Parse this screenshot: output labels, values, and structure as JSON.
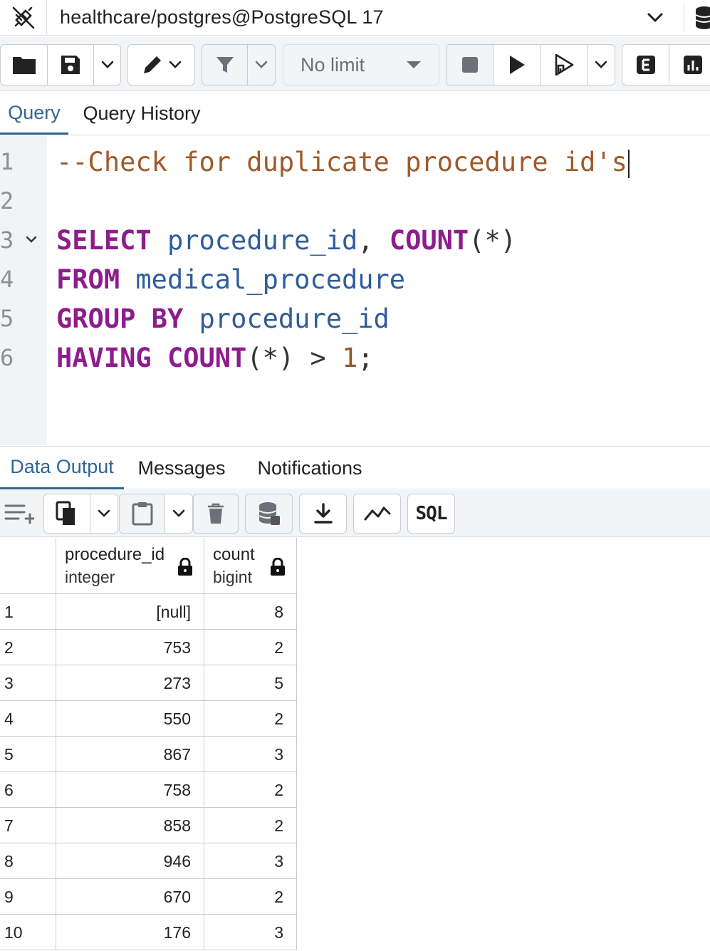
{
  "connection": {
    "label": "healthcare/postgres@PostgreSQL 17"
  },
  "toolbar": {
    "limit_label": "No limit"
  },
  "editor_tabs": {
    "query": "Query",
    "history": "Query History"
  },
  "editor": {
    "line_numbers": [
      "1",
      "2",
      "3",
      "4",
      "5",
      "6"
    ],
    "line1": {
      "comment": "--Check for duplicate procedure id's"
    },
    "line3": {
      "kw_select": "SELECT",
      "col": "procedure_id",
      "comma": ",",
      "kw_count": "COUNT",
      "arg": "(*)"
    },
    "line4": {
      "kw_from": "FROM",
      "table": "medical_procedure"
    },
    "line5": {
      "kw_group": "GROUP",
      "kw_by": "BY",
      "col": "procedure_id"
    },
    "line6": {
      "kw_having": "HAVING",
      "kw_count": "COUNT",
      "arg": "(*)",
      "op": ">",
      "num": "1",
      "semi": ";"
    }
  },
  "output_tabs": {
    "data_output": "Data Output",
    "messages": "Messages",
    "notifications": "Notifications"
  },
  "output_toolbar": {
    "sql_label": "SQL"
  },
  "grid": {
    "columns": [
      {
        "name": "procedure_id",
        "type": "integer"
      },
      {
        "name": "count",
        "type": "bigint"
      }
    ],
    "rows": [
      {
        "n": "1",
        "procedure_id": "[null]",
        "count": "8"
      },
      {
        "n": "2",
        "procedure_id": "753",
        "count": "2"
      },
      {
        "n": "3",
        "procedure_id": "273",
        "count": "5"
      },
      {
        "n": "4",
        "procedure_id": "550",
        "count": "2"
      },
      {
        "n": "5",
        "procedure_id": "867",
        "count": "3"
      },
      {
        "n": "6",
        "procedure_id": "758",
        "count": "2"
      },
      {
        "n": "7",
        "procedure_id": "858",
        "count": "2"
      },
      {
        "n": "8",
        "procedure_id": "946",
        "count": "3"
      },
      {
        "n": "9",
        "procedure_id": "670",
        "count": "2"
      },
      {
        "n": "10",
        "procedure_id": "176",
        "count": "3"
      }
    ]
  },
  "colors": {
    "accent": "#326690",
    "keyword": "#8e1c8e",
    "identifier": "#2f5c9a",
    "comment": "#a0592a"
  }
}
